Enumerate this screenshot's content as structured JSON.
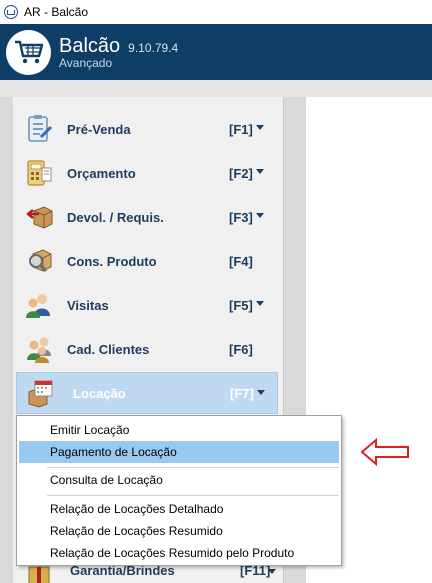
{
  "window": {
    "title": "AR - Balcão"
  },
  "header": {
    "app_title": "Balcão",
    "version": "9.10.79.4",
    "subtitle": "Avançado"
  },
  "nav": [
    {
      "label": "Pré-Venda",
      "shortcut": "[F1]",
      "has_dropdown": true,
      "icon": "clipboard-icon"
    },
    {
      "label": "Orçamento",
      "shortcut": "[F2]",
      "has_dropdown": true,
      "icon": "calculator-icon"
    },
    {
      "label": "Devol. / Requis.",
      "shortcut": "[F3]",
      "has_dropdown": true,
      "icon": "return-box-icon"
    },
    {
      "label": "Cons. Produto",
      "shortcut": "[F4]",
      "has_dropdown": false,
      "icon": "magnifier-box-icon"
    },
    {
      "label": "Visitas",
      "shortcut": "[F5]",
      "has_dropdown": true,
      "icon": "people-icon"
    },
    {
      "label": "Cad. Clientes",
      "shortcut": "[F6]",
      "has_dropdown": false,
      "icon": "customers-icon"
    },
    {
      "label": "Locação",
      "shortcut": "[F7]",
      "has_dropdown": true,
      "icon": "calendar-box-icon",
      "active": true
    },
    {
      "label": "Garantia/Brindes",
      "shortcut": "[F11]",
      "has_dropdown": true,
      "icon": "gift-icon"
    }
  ],
  "dropdown": {
    "items": [
      {
        "label": "Emitir Locação"
      },
      {
        "label": "Pagamento de Locação",
        "selected": true
      },
      {
        "label": "Consulta de Locação"
      },
      {
        "label": "Relação de Locações Detalhado"
      },
      {
        "label": "Relação de Locações Resumido"
      },
      {
        "label": "Relação de Locações Resumido pelo Produto"
      }
    ]
  },
  "colors": {
    "header_bg": "#0e3d66",
    "active_item_bg": "#bfd9f2",
    "menu_highlight": "#99c9ef",
    "label_text": "#1d3c5e",
    "pointer_arrow": "#e02020"
  }
}
